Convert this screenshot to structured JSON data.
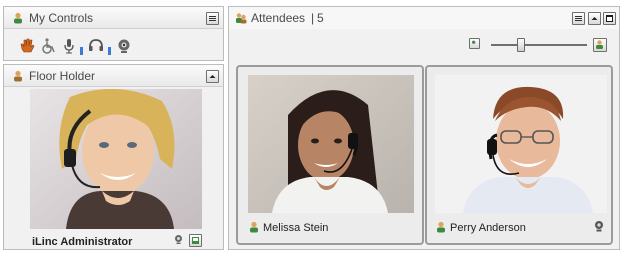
{
  "my_controls": {
    "title": "My Controls",
    "controls": [
      {
        "icon": "raise-hand-icon",
        "active": true
      },
      {
        "icon": "wheelchair-icon",
        "active": false
      },
      {
        "icon": "microphone-icon",
        "active": false
      },
      {
        "icon": "headset-icon",
        "active": false
      },
      {
        "icon": "webcam-icon",
        "active": false
      }
    ]
  },
  "floor_holder": {
    "title": "Floor Holder",
    "name": "iLinc Administrator"
  },
  "attendees": {
    "title": "Attendees",
    "separator": "|",
    "count": "5",
    "zoom_level": 0.3,
    "people": [
      {
        "name": "Melissa Stein",
        "camera": false
      },
      {
        "name": "Perry Anderson",
        "camera": true
      }
    ]
  },
  "colors": {
    "accent_blue": "#3a7bd5",
    "panel_bg": "#f1f1f1",
    "card_border": "#9b9b9b"
  }
}
